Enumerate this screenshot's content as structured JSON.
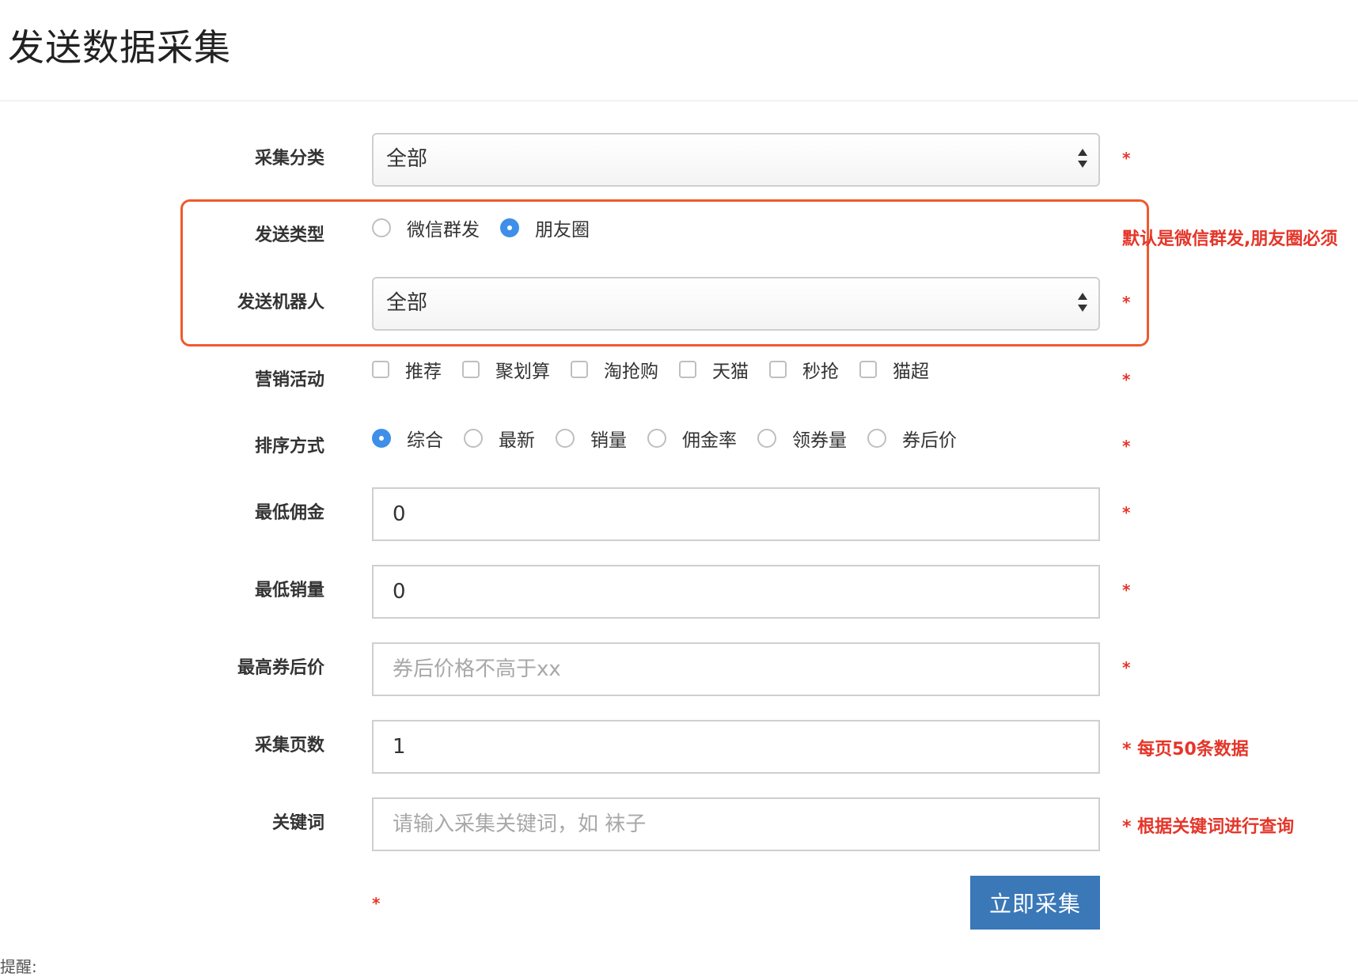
{
  "page": {
    "title": "发送数据采集"
  },
  "form": {
    "category": {
      "label": "采集分类",
      "value": "全部",
      "required": "*"
    },
    "send_type": {
      "label": "发送类型",
      "options": [
        {
          "label": "微信群发",
          "checked": false
        },
        {
          "label": "朋友圈",
          "checked": true
        }
      ],
      "note": "默认是微信群发,朋友圈必须"
    },
    "robot": {
      "label": "发送机器人",
      "value": "全部",
      "required": "*"
    },
    "marketing": {
      "label": "营销活动",
      "options": [
        "推荐",
        "聚划算",
        "淘抢购",
        "天猫",
        "秒抢",
        "猫超"
      ],
      "required": "*"
    },
    "sort": {
      "label": "排序方式",
      "options": [
        {
          "label": "综合",
          "checked": true
        },
        {
          "label": "最新",
          "checked": false
        },
        {
          "label": "销量",
          "checked": false
        },
        {
          "label": "佣金率",
          "checked": false
        },
        {
          "label": "领券量",
          "checked": false
        },
        {
          "label": "券后价",
          "checked": false
        }
      ],
      "required": "*"
    },
    "min_commission": {
      "label": "最低佣金",
      "value": "0",
      "required": "*"
    },
    "min_sales": {
      "label": "最低销量",
      "value": "0",
      "required": "*"
    },
    "max_price": {
      "label": "最高券后价",
      "value": "",
      "placeholder": "券后价格不高于xx",
      "required": "*"
    },
    "pages": {
      "label": "采集页数",
      "value": "1",
      "note": "* 每页50条数据"
    },
    "keyword": {
      "label": "关键词",
      "value": "",
      "placeholder": "请输入采集关键词，如 袜子",
      "note": "* 根据关键词进行查询"
    },
    "submit_required": "*",
    "submit_label": "立即采集"
  },
  "footer": {
    "partial_text": "提醒:"
  },
  "colors": {
    "accent": "#3a78b8",
    "required": "#e53529",
    "highlight": "#ee5a2e",
    "radio": "#3f8fe8"
  }
}
